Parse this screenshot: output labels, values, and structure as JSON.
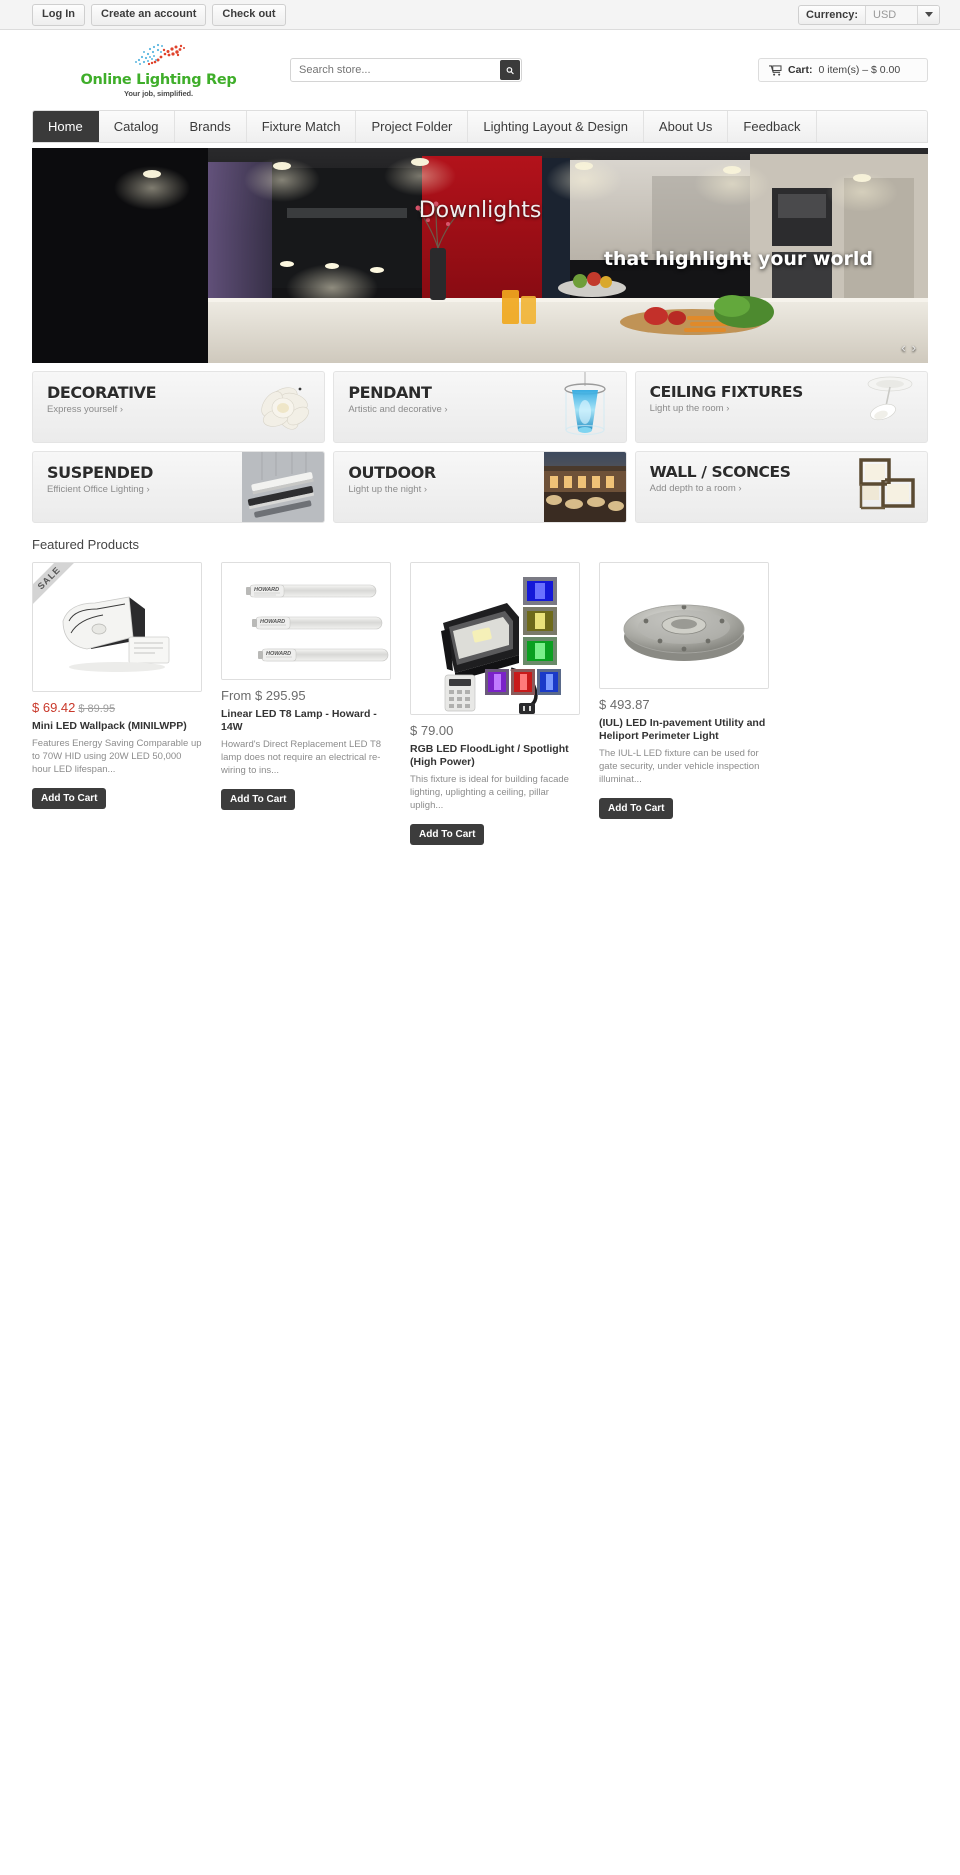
{
  "topbar": {
    "buttons": [
      {
        "label": "Log In",
        "name": "login-button"
      },
      {
        "label": "Create an account",
        "name": "create-account-button"
      },
      {
        "label": "Check out",
        "name": "checkout-button"
      }
    ],
    "currency_label": "Currency:",
    "currency_value": "USD"
  },
  "header": {
    "logo_name": "Online Lighting Rep",
    "logo_tagline": "Your job, simplified.",
    "search_placeholder": "Search store...",
    "search_value": "",
    "cart_label": "Cart:",
    "cart_summary": "0  item(s) – $ 0.00"
  },
  "nav": {
    "items": [
      {
        "label": "Home",
        "active": true
      },
      {
        "label": "Catalog",
        "active": false
      },
      {
        "label": "Brands",
        "active": false
      },
      {
        "label": "Fixture Match",
        "active": false
      },
      {
        "label": "Project Folder",
        "active": false
      },
      {
        "label": "Lighting Layout & Design",
        "active": false
      },
      {
        "label": "About Us",
        "active": false
      },
      {
        "label": "Feedback",
        "active": false
      }
    ]
  },
  "hero": {
    "headline": "Downlights",
    "subheadline": "that highlight your world",
    "prev_arrow": "‹",
    "next_arrow": "›"
  },
  "tiles": [
    {
      "title": "DECORATIVE",
      "subtitle": "Express yourself ›",
      "image": "white-flower-pendant"
    },
    {
      "title": "PENDANT",
      "subtitle": "Artistic and decorative ›",
      "image": "blue-glass-pendant"
    },
    {
      "title": "CEILING FIXTURES",
      "subtitle": "Light up the room ›",
      "image": "white-ceiling-fixture"
    },
    {
      "title": "SUSPENDED",
      "subtitle": "Efficient Office Lighting ›",
      "image": "linear-suspended-fixture"
    },
    {
      "title": "OUTDOOR",
      "subtitle": "Light up the night ›",
      "image": "outdoor-walkway-lights"
    },
    {
      "title": "WALL / SCONCES",
      "subtitle": "Add depth to a room ›",
      "image": "wall-sconce"
    }
  ],
  "featured": {
    "heading": "Featured Products",
    "add_to_cart_label": "Add To Cart",
    "sale_badge": "SALE",
    "products": [
      {
        "badge": "SALE",
        "price": "$ 69.42",
        "old_price": "$ 89.95",
        "title": "Mini LED Wallpack (MINILWPP)",
        "desc": "Features Energy Saving Comparable up to 70W HID using 20W LED 50,000 hour LED lifespan...",
        "image": "mini-led-wallpack"
      },
      {
        "badge": "",
        "price": "From $ 295.95",
        "old_price": "",
        "title": "Linear LED T8 Lamp - Howard - 14W",
        "desc": "Howard's Direct Replacement LED T8 lamp does not require an electrical re-wiring to ins...",
        "image": "linear-led-t8-lamps"
      },
      {
        "badge": "",
        "price": "$ 79.00",
        "old_price": "",
        "title": "RGB LED FloodLight / Spotlight (High Power)",
        "desc": "This fixture is ideal for building facade lighting, uplighting a ceiling, pillar upligh...",
        "image": "rgb-led-floodlight"
      },
      {
        "badge": "",
        "price": "$ 493.87",
        "old_price": "",
        "title": "(IUL) LED In-pavement Utility and Heliport Perimeter Light",
        "desc": "The IUL-L LED fixture can be used for gate security, under vehicle inspection illuminat...",
        "image": "in-pavement-light"
      }
    ]
  },
  "colors": {
    "brand_green": "#3fae2a",
    "sale_red": "#c9392b",
    "dark": "#3a3a3a"
  }
}
